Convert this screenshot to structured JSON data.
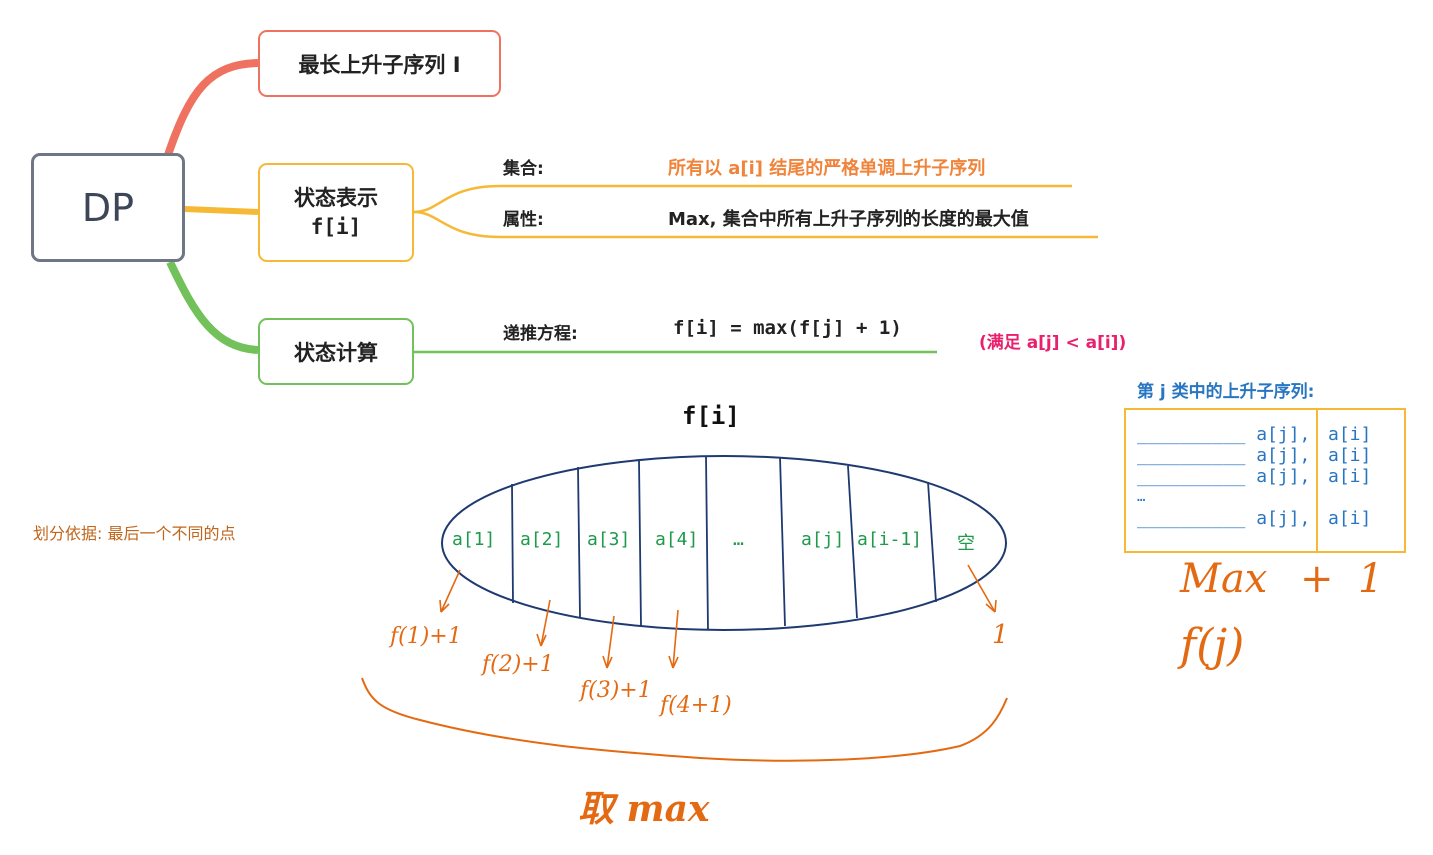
{
  "root": {
    "label": "DP"
  },
  "branches": {
    "lis": {
      "label": "最长上升子序列 I"
    },
    "state": {
      "label_line1": "状态表示",
      "label_line2": "f[i]",
      "set_label": "集合:",
      "set_value": "所有以 a[i] 结尾的严格单调上升子序列",
      "attr_label": "属性:",
      "attr_value": "Max, 集合中所有上升子序列的长度的最大值"
    },
    "compute": {
      "label": "状态计算",
      "recur_label": "递推方程:",
      "recur_value": "f[i] = max(f[j] + 1)",
      "condition": "(满足 a[j] < a[i])"
    }
  },
  "set_diagram": {
    "title": "f[i]",
    "partitions": [
      "a[1]",
      "a[2]",
      "a[3]",
      "a[4]",
      "…",
      "a[j]",
      "a[i-1]",
      "空"
    ],
    "basis": "划分依据: 最后一个不同的点",
    "hand_notes": [
      "f(1)+1",
      "f(2)+1",
      "f(3)+1",
      "f(4+1)",
      "1"
    ],
    "take_max": "取 max"
  },
  "class_j": {
    "title": "第 j 类中的上升子序列:",
    "rows_left": [
      "__________ a[j],",
      "__________ a[j],",
      "__________ a[j],",
      "…",
      "__________ a[j],"
    ],
    "rows_right": [
      "a[i]",
      "a[i]",
      "a[i]",
      "",
      "a[i]"
    ],
    "note_max": "Max",
    "note_plus": "+",
    "note_one": "1",
    "note_fj": "f(j)"
  },
  "colors": {
    "red": "#ef7260",
    "yellow": "#f6b935",
    "green": "#72c15a",
    "orange": "#f0843b",
    "pink": "#e8206e",
    "blue": "#2876c2",
    "hand": "#e36a12",
    "brown": "#c0651a"
  }
}
